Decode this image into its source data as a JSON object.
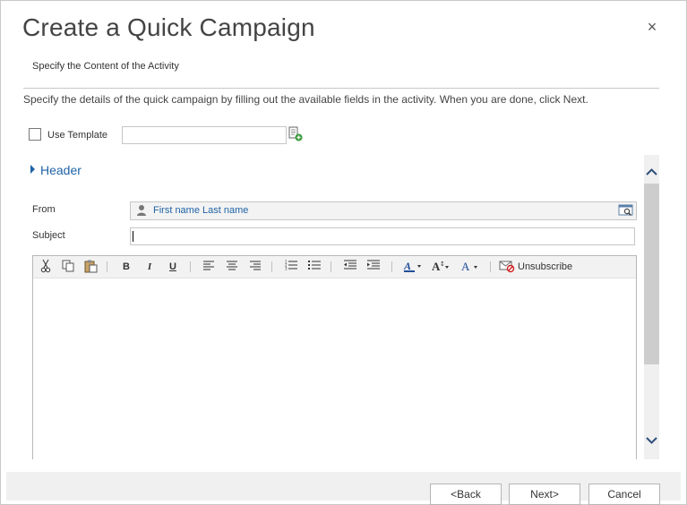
{
  "dialog": {
    "title": "Create a Quick Campaign",
    "subtitle": "Specify the Content of the Activity",
    "instructions": "Specify the details of the quick campaign by filling out the available fields in the activity. When you are done, click Next.",
    "close_glyph": "×"
  },
  "template": {
    "checkbox_label": "Use Template",
    "checked": false,
    "value": ""
  },
  "header_section": {
    "label": "Header",
    "expanded": false
  },
  "fields": {
    "from_label": "From",
    "from_value": "First name Last name",
    "subject_label": "Subject",
    "subject_value": ""
  },
  "toolbar": {
    "bold": "B",
    "italic": "I",
    "underline": "U",
    "unsubscribe": "Unsubscribe"
  },
  "buttons": {
    "back": "<Back",
    "next": "Next>",
    "cancel": "Cancel"
  },
  "colors": {
    "link": "#1f63a6",
    "border": "#c6c6c6",
    "toolbar_bg": "#f2f2f2"
  },
  "icons": [
    "close-icon",
    "template-lookup-icon",
    "person-icon",
    "lookup-icon",
    "cut-icon",
    "copy-icon",
    "paste-icon",
    "align-left-icon",
    "align-center-icon",
    "align-right-icon",
    "numbered-list-icon",
    "bulleted-list-icon",
    "decrease-indent-icon",
    "increase-indent-icon",
    "highlight-color-icon",
    "font-size-icon",
    "font-color-icon",
    "unsubscribe-icon",
    "scroll-up-icon",
    "scroll-down-icon"
  ]
}
